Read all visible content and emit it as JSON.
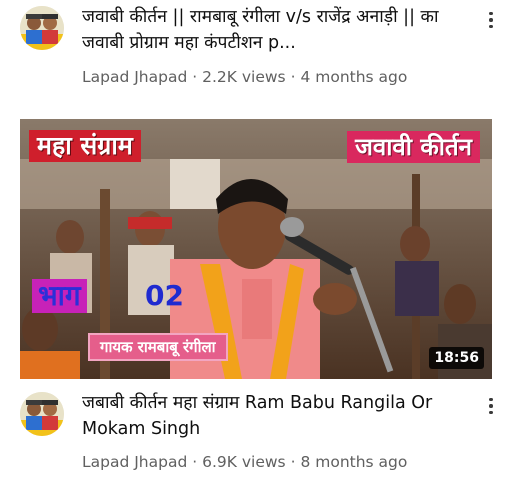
{
  "videos": [
    {
      "title": "जवाबी कीर्तन || रामबाबू रंगीला v/s राजेंद्र अनाड़ी || का जवाबी प्रोग्राम महा कंपटीशन p...",
      "channel": "Lapad Jhapad",
      "views": "2.2K views",
      "age": "4 months ago",
      "separator": "·"
    },
    {
      "title": "जबाबी कीर्तन महा संग्राम Ram Babu Rangila Or Mokam Singh",
      "channel": "Lapad Jhapad",
      "views": "6.9K views",
      "age": "8 months ago",
      "separator": "·",
      "duration": "18:56",
      "thumbnail": {
        "top_left_text": "महा संग्राम",
        "top_right_text": "जवावी कीर्तन",
        "part_label": "भाग",
        "part_number": "02",
        "singer_caption": "गायक रामबाबू रंगीला"
      }
    }
  ],
  "icons": {
    "menu": "more-vert-icon",
    "avatar": "channel-avatar"
  }
}
